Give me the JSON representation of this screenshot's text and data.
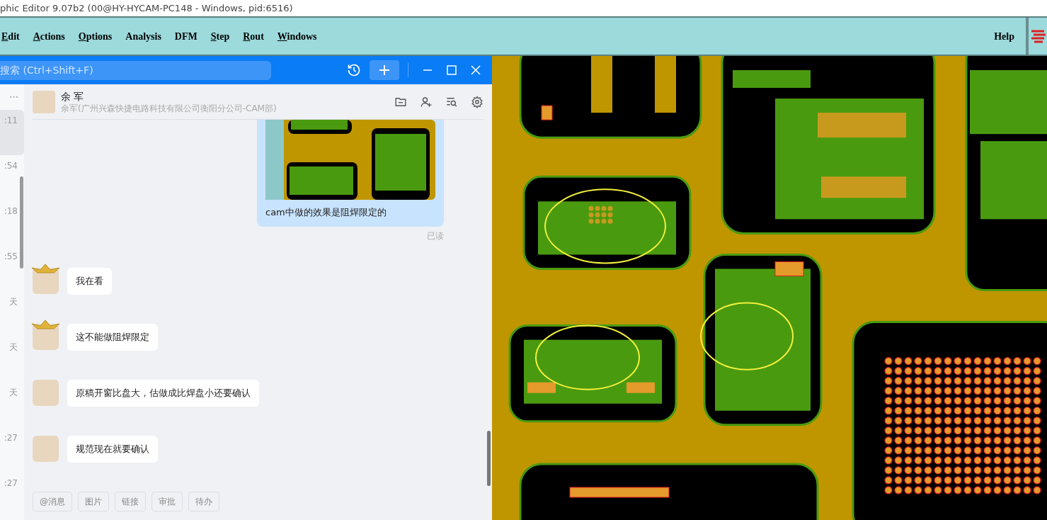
{
  "window": {
    "title": "phic Editor 9.07b2 (00@HY-HYCAM-PC148 - Windows, pid:6516)"
  },
  "menu": [
    {
      "label": "Edit",
      "underlined": true
    },
    {
      "label": "Actions",
      "underlined": true
    },
    {
      "label": "Options",
      "underlined": true
    },
    {
      "label": "Analysis",
      "underlined": false
    },
    {
      "label": "DFM",
      "underlined": false
    },
    {
      "label": "Step",
      "underlined": true
    },
    {
      "label": "Rout",
      "underlined": true
    },
    {
      "label": "Windows",
      "underlined": true
    }
  ],
  "help": "Help",
  "chat": {
    "search": {
      "placeholder": "搜索 (Ctrl+Shift+F)"
    },
    "sidebar": {
      "more": "⋯",
      "items": [
        {
          "time": ":11",
          "selected": true
        },
        {
          "time": ":54",
          "selected": false
        },
        {
          "time": ":18",
          "selected": false
        },
        {
          "time": ":55",
          "selected": false
        },
        {
          "time": "天",
          "selected": false
        },
        {
          "time": "天",
          "selected": false
        },
        {
          "time": "天",
          "selected": false
        },
        {
          "time": ":27",
          "selected": false
        },
        {
          "time": ":27",
          "selected": false
        }
      ]
    },
    "contact": {
      "name": "余 军",
      "subtitle": "余军(广州兴森快捷电路科技有限公司衡阳分公司-CAM部)"
    },
    "sent": {
      "text": "cam中做的效果是阻焊限定的",
      "status": "已读"
    },
    "messages": [
      {
        "text": "我在看",
        "crowned": true
      },
      {
        "text": "这不能做阻焊限定",
        "crowned": true
      },
      {
        "text": "原稿开窗比盘大，估做成比焊盘小还要确认",
        "crowned": false
      },
      {
        "text": "规范现在就要确认",
        "crowned": false
      }
    ],
    "quick_actions": [
      "@消息",
      "图片",
      "链接",
      "审批",
      "待办"
    ]
  }
}
